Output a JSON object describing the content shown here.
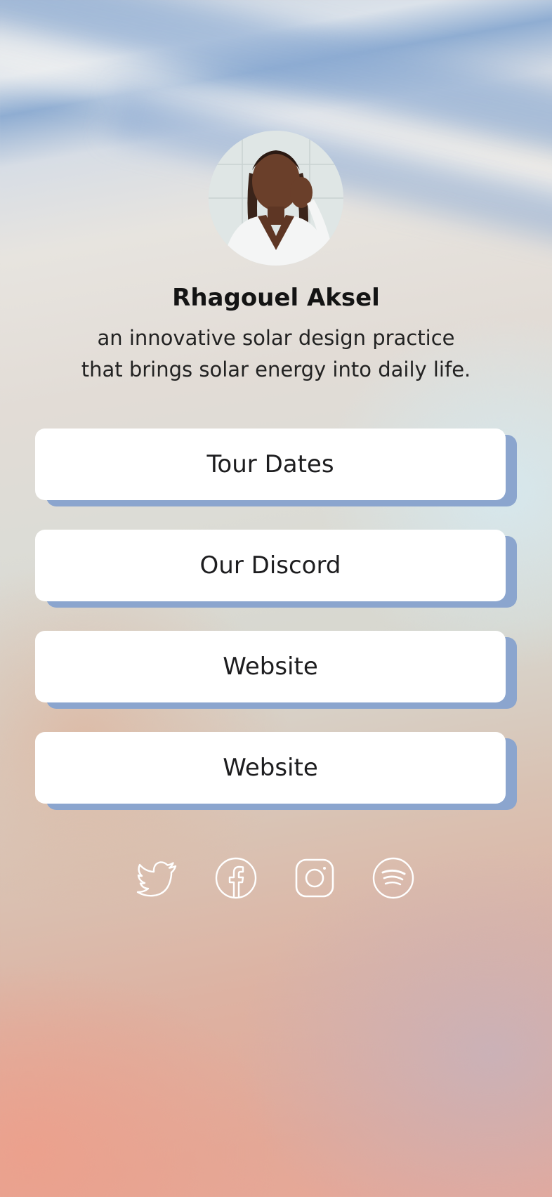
{
  "profile": {
    "name": "Rhagouel Aksel",
    "bio_line1": "an innovative solar design practice",
    "bio_line2": "that brings solar energy into daily life."
  },
  "links": [
    {
      "label": "Tour Dates"
    },
    {
      "label": "Our Discord"
    },
    {
      "label": "Website"
    },
    {
      "label": "Website"
    }
  ],
  "socials": [
    {
      "icon": "twitter-icon"
    },
    {
      "icon": "facebook-icon"
    },
    {
      "icon": "instagram-icon"
    },
    {
      "icon": "spotify-icon"
    }
  ],
  "colors": {
    "button_bg": "#ffffff",
    "button_shadow": "#8ba5ce",
    "text": "#1d1d1f",
    "icon": "#ffffff"
  }
}
